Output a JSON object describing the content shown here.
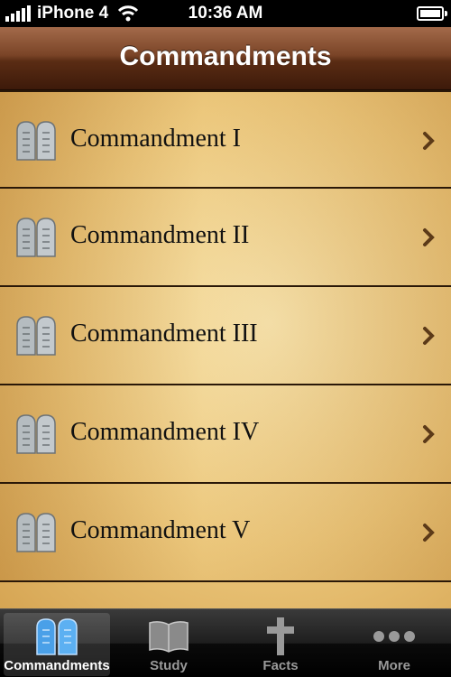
{
  "status_bar": {
    "carrier": "iPhone 4",
    "time": "10:36 AM"
  },
  "nav_bar": {
    "title": "Commandments"
  },
  "list": {
    "items": [
      {
        "label": "Commandment I",
        "icon": "stone-tablets-icon"
      },
      {
        "label": "Commandment II",
        "icon": "stone-tablets-icon"
      },
      {
        "label": "Commandment III",
        "icon": "stone-tablets-icon"
      },
      {
        "label": "Commandment IV",
        "icon": "stone-tablets-icon"
      },
      {
        "label": "Commandment V",
        "icon": "stone-tablets-icon"
      }
    ]
  },
  "tab_bar": {
    "selected": "Commandments",
    "tabs": [
      {
        "label": "Commandments",
        "icon": "tablets-icon"
      },
      {
        "label": "Study",
        "icon": "book-icon"
      },
      {
        "label": "Facts",
        "icon": "cross-icon"
      },
      {
        "label": "More",
        "icon": "more-dots-icon"
      }
    ]
  },
  "colors": {
    "nav_bar": "#6b3a1f",
    "parchment": "#ebc67a",
    "tab_selected": "#4aa0e8"
  }
}
